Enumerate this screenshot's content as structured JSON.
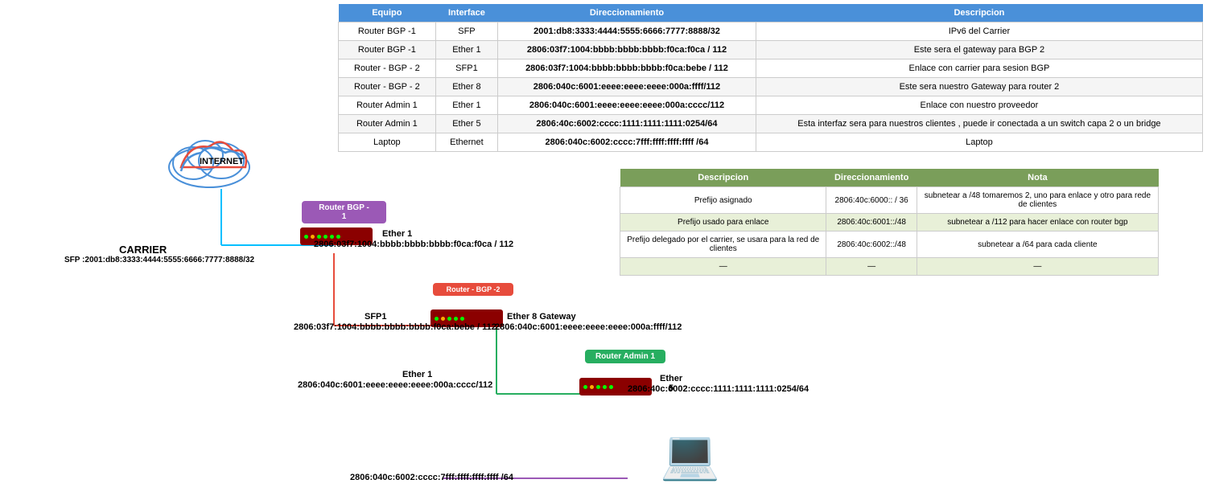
{
  "table": {
    "headers": [
      "Equipo",
      "Interface",
      "Direccionamiento",
      "Descripcion"
    ],
    "rows": [
      {
        "equipo": "Router BGP -1",
        "interface": "SFP",
        "direccionamiento": "2001:db8:3333:4444:5555:6666:7777:8888/32",
        "descripcion": "IPv6 del Carrier"
      },
      {
        "equipo": "Router BGP -1",
        "interface": "Ether 1",
        "direccionamiento": "2806:03f7:1004:bbbb:bbbb:bbbb:f0ca:f0ca / 112",
        "descripcion": "Este sera el gateway para BGP 2"
      },
      {
        "equipo": "Router - BGP - 2",
        "interface": "SFP1",
        "direccionamiento": "2806:03f7:1004:bbbb:bbbb:bbbb:f0ca:bebe / 112",
        "descripcion": "Enlace con carrier para sesion BGP"
      },
      {
        "equipo": "Router - BGP - 2",
        "interface": "Ether 8",
        "direccionamiento": "2806:040c:6001:eeee:eeee:eeee:000a:ffff/112",
        "descripcion": "Este sera nuestro Gateway para router 2"
      },
      {
        "equipo": "Router Admin 1",
        "interface": "Ether 1",
        "direccionamiento": "2806:040c:6001:eeee:eeee:eeee:000a:cccc/112",
        "descripcion": "Enlace con nuestro proveedor"
      },
      {
        "equipo": "Router Admin 1",
        "interface": "Ether 5",
        "direccionamiento": "2806:40c:6002:cccc:1111:1111:1111:0254/64",
        "descripcion": "Esta interfaz sera para nuestros clientes , puede ir conectada a un switch capa 2 o un bridge"
      },
      {
        "equipo": "Laptop",
        "interface": "Ethernet",
        "direccionamiento": "2806:040c:6002:cccc:7fff:ffff:ffff:ffff /64",
        "descripcion": "Laptop"
      }
    ]
  },
  "second_table": {
    "headers": [
      "Descripcion",
      "Direccionamiento",
      "Nota"
    ],
    "rows": [
      {
        "descripcion": "Prefijo asignado",
        "direccionamiento": "2806:40c:6000:: / 36",
        "nota": "subnetear a /48  tomaremos 2, uno para enlace y otro para rede de clientes"
      },
      {
        "descripcion": "Prefijo usado para enlace",
        "direccionamiento": "2806:40c:6001::/48",
        "nota": "subnetear a /112 para hacer enlace con router bgp"
      },
      {
        "descripcion": "Prefijo delegado por el carrier, se usara para la red de clientes",
        "direccionamiento": "2806:40c:6002::/48",
        "nota": "subnetear a /64 para cada cliente"
      },
      {
        "descripcion": "—",
        "direccionamiento": "—",
        "nota": "—"
      }
    ]
  },
  "diagram": {
    "internet_label": "INTERNET",
    "carrier_label": "CARRIER",
    "carrier_sfp": "SFP :2001:db8:3333:4444:5555:6666:7777:8888/32",
    "router_bgp1_label": "Router BGP -\n1",
    "router_bgp2_label": "Router - BGP -2",
    "router_admin1_label": "Router Admin 1",
    "ether1_bgp1": "Ether 1",
    "ether1_bgp1_ip": "2806:03f7:1004:bbbb:bbbb:bbbb:f0ca:f0ca / 112",
    "sfp1_bgp2": "SFP1",
    "sfp1_bgp2_ip": "2806:03f7:1004:bbbb:bbbb:bbbb:f0ca:bebe / 112",
    "ether8_gateway_label": "Ether 8 Gateway",
    "ether8_gateway_ip": "2806:040c:6001:eeee:eeee:eeee:000a:ffff/112",
    "ether1_admin": "Ether 1",
    "ether1_admin_ip": "2806:040c:6001:eeee:eeee:eeee:000a:cccc/112",
    "ether5_admin": "Ether 5",
    "ether5_admin_ip": "2806:40c:6002:cccc:1111:1111:1111:0254/64",
    "laptop_ip": "2806:040c:6002:cccc:7fff:ffff:ffff:ffff /64"
  }
}
